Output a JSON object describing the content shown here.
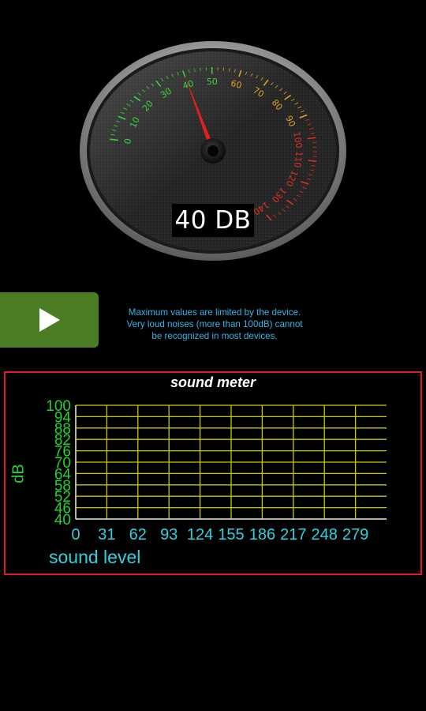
{
  "gauge": {
    "reading": "40 DB",
    "value": 40,
    "min": 0,
    "max": 140,
    "tick_labels": [
      "0",
      "10",
      "20",
      "30",
      "40",
      "50",
      "60",
      "70",
      "80",
      "90",
      "100",
      "110",
      "120",
      "130",
      "140"
    ],
    "needle_color": "#e02020"
  },
  "controls": {
    "play_icon": "play-icon"
  },
  "info_lines": [
    "Maximum values are limited by the device.",
    "Very loud noises (more than 100dB) cannot",
    "be recognized in most devices."
  ],
  "chart_data": {
    "type": "line",
    "title": "sound meter",
    "xlabel": "sound level",
    "ylabel": "dB",
    "x_ticks": [
      "0",
      "31",
      "62",
      "93",
      "124",
      "155",
      "186",
      "217",
      "248",
      "279"
    ],
    "y_ticks": [
      "100",
      "94",
      "88",
      "82",
      "76",
      "70",
      "64",
      "58",
      "52",
      "46",
      "40"
    ],
    "xlim": [
      0,
      310
    ],
    "ylim": [
      40,
      100
    ],
    "grid": true,
    "series": [],
    "grid_color": "#c8c800",
    "colors": {
      "ytick": "#22d32a",
      "xtick": "#2bd3e0",
      "border": "#e01b24"
    }
  }
}
